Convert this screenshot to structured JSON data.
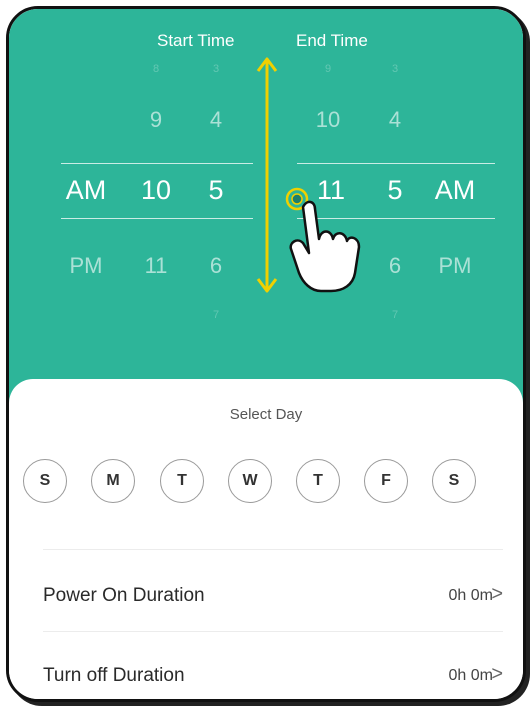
{
  "picker": {
    "start_label": "Start Time",
    "end_label": "End Time",
    "start": {
      "ampm": {
        "selected": "AM",
        "below": "PM"
      },
      "hour": {
        "top_tiny": "8",
        "above": "9",
        "selected": "10",
        "below": "11"
      },
      "minute": {
        "top_tiny": "3",
        "above": "4",
        "selected": "5",
        "below": "6",
        "bottom_tiny": "7"
      }
    },
    "end": {
      "hour": {
        "top_tiny": "9",
        "above": "10",
        "selected": "11"
      },
      "minute": {
        "top_tiny": "3",
        "above": "4",
        "selected": "5",
        "below": "6",
        "bottom_tiny": "7"
      },
      "ampm": {
        "selected": "AM",
        "below": "PM"
      }
    }
  },
  "select_day": {
    "title": "Select Day",
    "days": [
      "S",
      "M",
      "T",
      "W",
      "T",
      "F",
      "S"
    ]
  },
  "durations": [
    {
      "label": "Power On Duration",
      "value": "0h 0m",
      "chevron": ">"
    },
    {
      "label": "Turn off Duration",
      "value": "0h 0m",
      "chevron": ">"
    }
  ],
  "colors": {
    "accent": "#2db599",
    "arrow": "#f0d000"
  },
  "icons": {
    "gesture": "tap-hand-icon",
    "scroll": "vertical-double-arrow-icon"
  }
}
